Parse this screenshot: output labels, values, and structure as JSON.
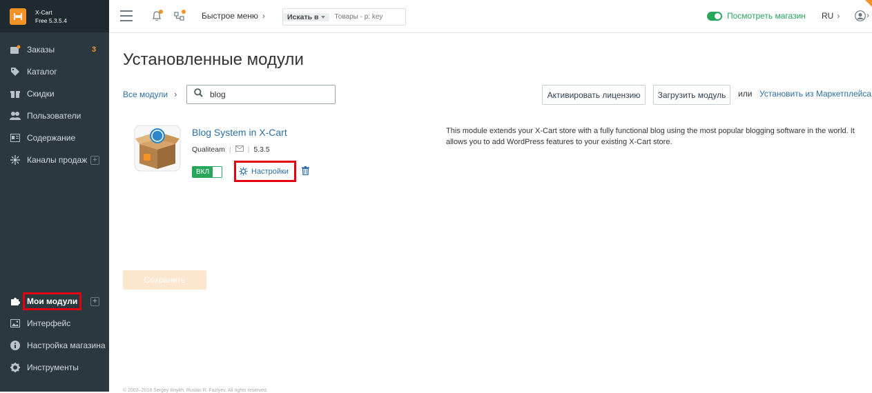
{
  "brand": {
    "name": "X-Cart",
    "version": "Free 5.3.5.4"
  },
  "sidebar": {
    "items": [
      {
        "label": "Заказы",
        "badge": "3",
        "icon": "orders-icon"
      },
      {
        "label": "Каталог",
        "icon": "tag-icon"
      },
      {
        "label": "Скидки",
        "icon": "gift-icon"
      },
      {
        "label": "Пользователи",
        "icon": "users-icon"
      },
      {
        "label": "Содержание",
        "icon": "content-icon"
      },
      {
        "label": "Каналы продаж",
        "icon": "sales-channels-icon",
        "plus": "+"
      }
    ],
    "bottom_items": [
      {
        "label": "Мои модули",
        "icon": "puzzle-icon",
        "plus": "+"
      },
      {
        "label": "Интерфейс",
        "icon": "image-icon"
      },
      {
        "label": "Настройка магазина",
        "icon": "info-icon"
      },
      {
        "label": "Инструменты",
        "icon": "gear-icon"
      }
    ]
  },
  "topbar": {
    "quick_menu": "Быстрое меню",
    "search_in_label": "Искать в",
    "search_placeholder": "Товары - p: key",
    "view_store": "Посмотреть магазин",
    "language": "RU"
  },
  "main": {
    "title": "Установленные модули",
    "breadcrumb_all": "Все модули",
    "filter_value": "blog",
    "activate_license": "Активировать лицензию",
    "upload_module": "Загрузить модуль",
    "or": "или",
    "install_from_marketplace": "Установить из Маркетплейса",
    "module": {
      "name": "Blog System in X-Cart",
      "author": "Qualiteam",
      "version": "5.3.5",
      "switch_label": "ВКЛ",
      "settings_label": "Настройки",
      "description": "This module extends your X-Cart store with a fully functional blog using the most popular blogging software in the world. It allows you to add WordPress features to your existing X-Cart store."
    },
    "save_button": "Сохранить",
    "footer": "© 2002–2018 Sergey Ilinykh, Ruslan R. Fazlyev. All rights reserved."
  },
  "colors": {
    "accent": "#f39325",
    "sidebar": "#2b3840",
    "link": "#2c6ea3",
    "green": "#27a65c",
    "highlight": "#e3000f"
  }
}
